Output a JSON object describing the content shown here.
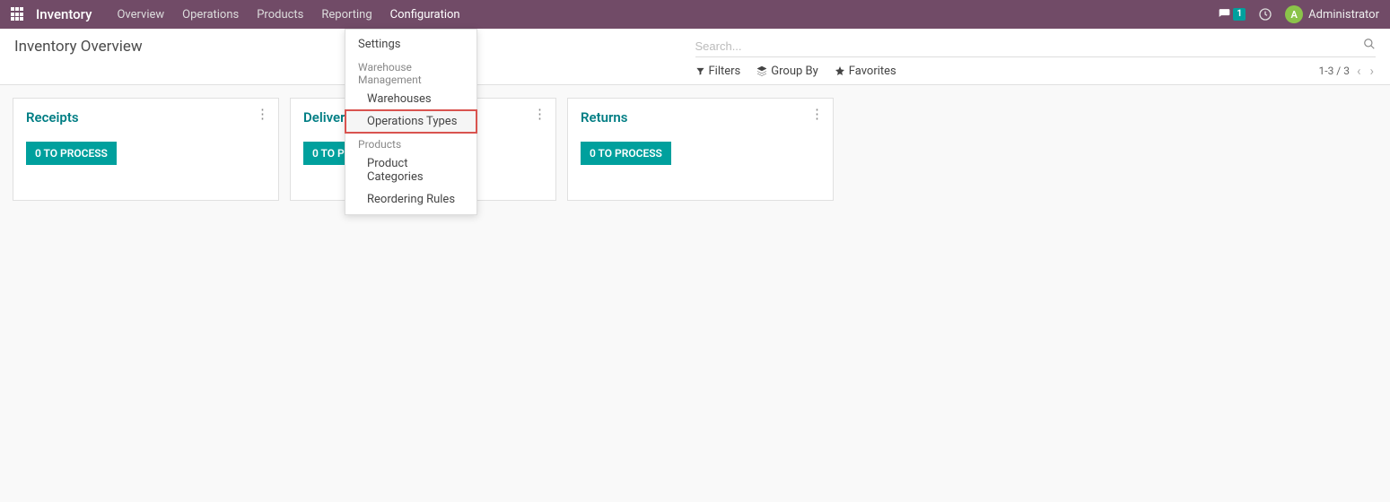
{
  "topnav": {
    "app_title": "Inventory",
    "items": [
      "Overview",
      "Operations",
      "Products",
      "Reporting",
      "Configuration"
    ],
    "active_index": 4,
    "messages_badge": "1",
    "user_initial": "A",
    "user_name": "Administrator"
  },
  "dropdown": {
    "settings_label": "Settings",
    "wm_header": "Warehouse Management",
    "wm_items": [
      "Warehouses",
      "Operations Types"
    ],
    "wm_highlight_index": 1,
    "products_header": "Products",
    "products_items": [
      "Product Categories",
      "Reordering Rules"
    ]
  },
  "controlbar": {
    "page_title": "Inventory Overview",
    "search_placeholder": "Search...",
    "filters_label": "Filters",
    "groupby_label": "Group By",
    "favorites_label": "Favorites",
    "pager_text": "1-3 / 3"
  },
  "cards": [
    {
      "title": "Receipts",
      "button": "0 TO PROCESS"
    },
    {
      "title": "Delivery Orders",
      "button": "0 TO PROCESS"
    },
    {
      "title": "Returns",
      "button": "0 TO PROCESS"
    }
  ]
}
